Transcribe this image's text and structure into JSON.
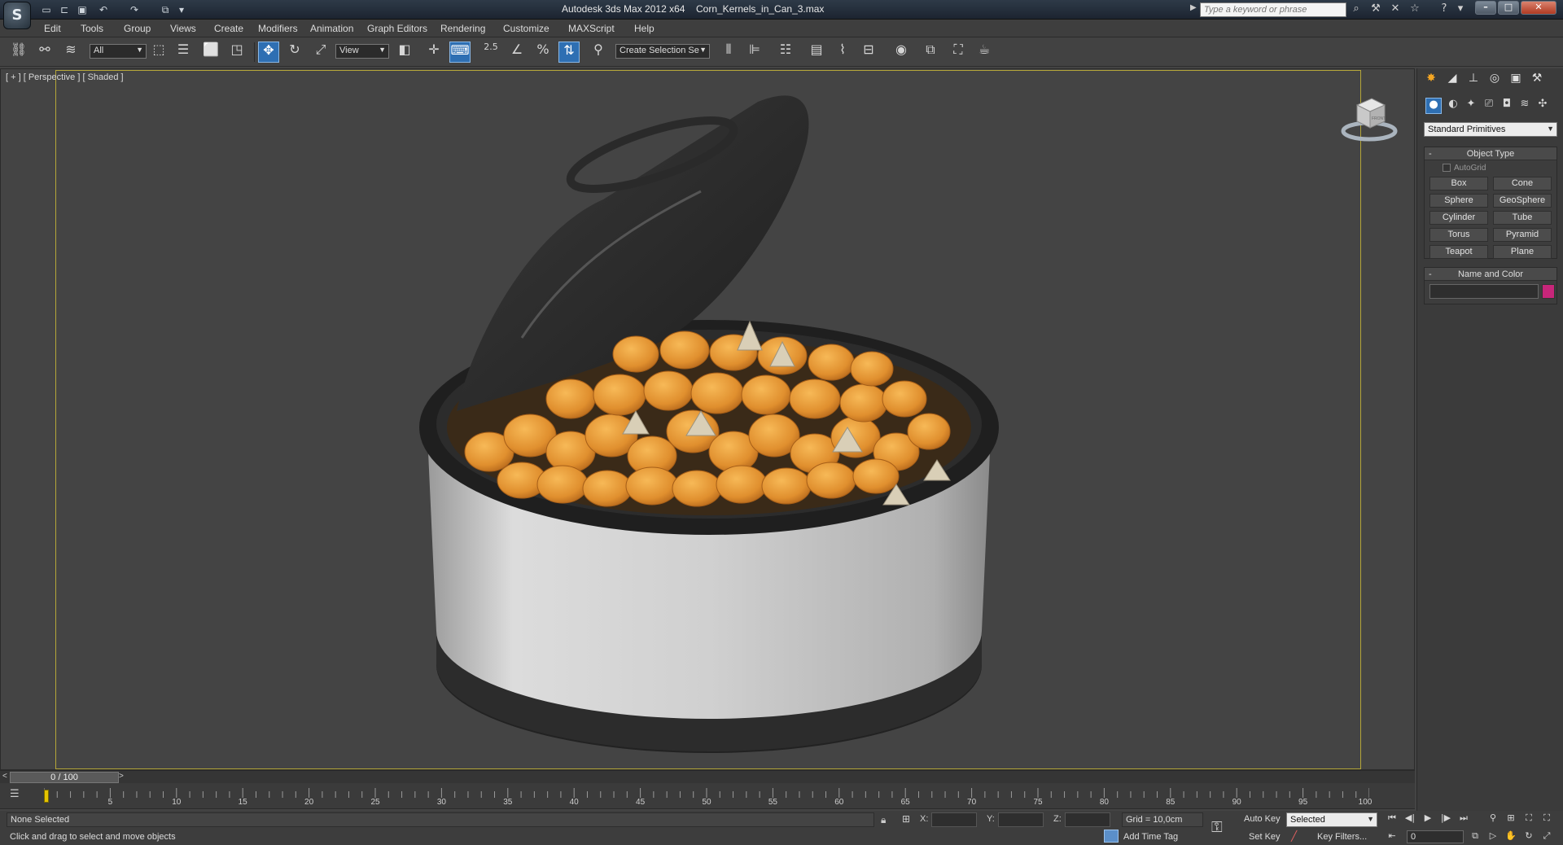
{
  "titlebar": {
    "app_title": "Autodesk 3ds Max  2012 x64",
    "file_name": "Corn_Kernels_in_Can_3.max",
    "search_placeholder": "Type a keyword or phrase",
    "logo_icon": "3ds-max-logo-icon",
    "quick_access_icons": [
      "new-file-icon",
      "open-file-icon",
      "save-icon",
      "undo-icon",
      "redo-icon",
      "project-folder-icon"
    ]
  },
  "menu": [
    "Edit",
    "Tools",
    "Group",
    "Views",
    "Create",
    "Modifiers",
    "Animation",
    "Graph Editors",
    "Rendering",
    "Customize",
    "MAXScript",
    "Help"
  ],
  "toolbar": {
    "selection_filter": "All",
    "reference_coord": "View",
    "selection_set_placeholder": "Create Selection Se",
    "snap_angle_label": "2.5",
    "active_tool": "select-and-move"
  },
  "viewport": {
    "label": "[ + ] [ Perspective ] [ Shaded ]",
    "viewcube_label": "FRONT"
  },
  "command_panel": {
    "category": "Standard Primitives",
    "object_type_title": "Object Type",
    "autogrid_label": "AutoGrid",
    "primitives": [
      "Box",
      "Cone",
      "Sphere",
      "GeoSphere",
      "Cylinder",
      "Tube",
      "Torus",
      "Pyramid",
      "Teapot",
      "Plane"
    ],
    "name_color_title": "Name and Color",
    "object_color": "#c7267a",
    "rollout_toggle": "-"
  },
  "timeline": {
    "position_label": "0 / 100",
    "ticks": [
      "0",
      "5",
      "10",
      "15",
      "20",
      "25",
      "30",
      "35",
      "40",
      "45",
      "50",
      "55",
      "60",
      "65",
      "70",
      "75",
      "80",
      "85",
      "90",
      "95",
      "100"
    ]
  },
  "status": {
    "selection": "None Selected",
    "prompt": "Click and drag to select and move objects",
    "x_label": "X:",
    "y_label": "Y:",
    "z_label": "Z:",
    "grid": "Grid = 10,0cm",
    "add_time_tag": "Add Time Tag"
  },
  "anim": {
    "auto_key": "Auto Key",
    "set_key": "Set Key",
    "key_mode": "Selected",
    "key_filters": "Key Filters...",
    "current_frame": "0"
  },
  "colors": {
    "viewport_bg": "#444444",
    "safe_frame": "#b5a639",
    "active_tool": "#2e6fb3",
    "kernel": "#e59a3c",
    "can_label": "#d6d6d6",
    "can_rim": "#2a2a2a"
  }
}
